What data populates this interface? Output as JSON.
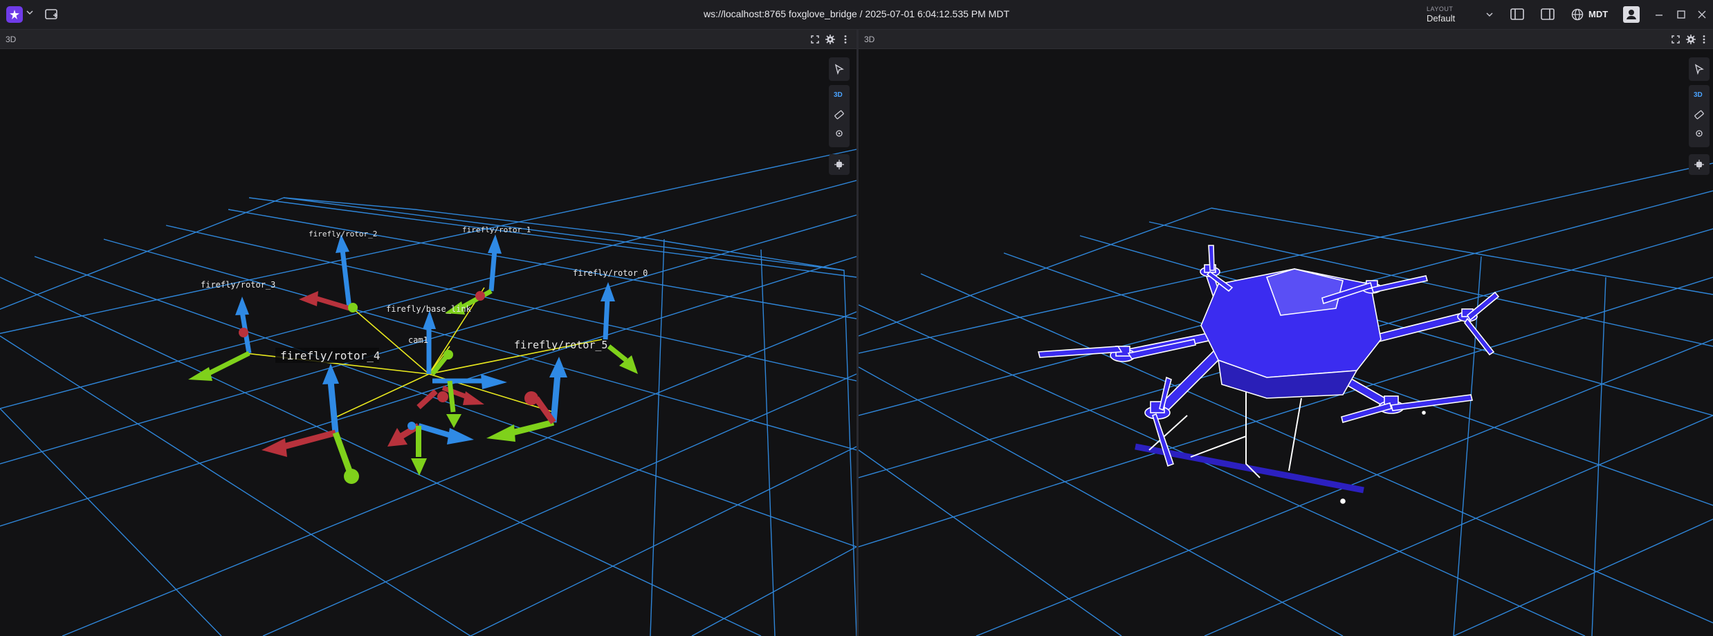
{
  "topbar": {
    "connection_title": "ws://localhost:8765 foxglove_bridge / 2025-07-01 6:04:12.535 PM MDT",
    "layout_label": "LAYOUT",
    "layout_value": "Default",
    "timezone": "MDT"
  },
  "panels": [
    {
      "title": "3D",
      "view_mode": "3D",
      "frame_labels": [
        "firefly/rotor_2",
        "firefly/rotor_1",
        "firefly/rotor_3",
        "firefly/rotor_0",
        "firefly/base_link",
        "cam1",
        "firefly/rotor_4",
        "firefly/rotor_5"
      ]
    },
    {
      "title": "3D",
      "view_mode": "3D"
    }
  ],
  "colors": {
    "grid": "#2f86d9",
    "axis_x": "#b8323c",
    "axis_y": "#7fd11b",
    "axis_z": "#2f8ae5",
    "tf_link": "#e8e81e",
    "drone_fill": "#3b2cf0",
    "accent": "#6f3be8"
  },
  "icons": [
    "app-logo-icon",
    "add-panel-icon",
    "left-sidebar-icon",
    "right-sidebar-icon",
    "globe-icon",
    "user-icon",
    "minimize-icon",
    "maximize-icon",
    "close-icon",
    "fullscreen-icon",
    "settings-icon",
    "more-icon",
    "select-cursor-icon",
    "ruler-icon",
    "publish-point-icon",
    "follow-camera-icon"
  ]
}
